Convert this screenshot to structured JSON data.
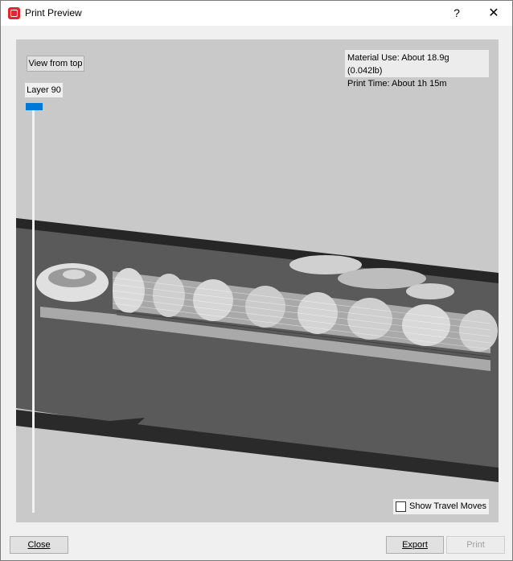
{
  "window": {
    "title": "Print Preview",
    "help_label": "?",
    "close_label": "✕"
  },
  "viewport": {
    "view_from_top_label": "View from top",
    "material_use": "Material Use: About 18.9g (0.042lb)",
    "print_time": "Print Time: About 1h 15m",
    "layer_label": "Layer 90",
    "show_travel_moves_label": "Show Travel Moves",
    "show_travel_moves_checked": false
  },
  "footer": {
    "close_label": "Close",
    "export_label": "Export",
    "print_label": "Print",
    "print_enabled": false
  },
  "colors": {
    "accent": "#0078d7",
    "app_icon": "#e2262d",
    "viewport_bg": "#c9c9c9",
    "bed": "#5a5a5a"
  }
}
